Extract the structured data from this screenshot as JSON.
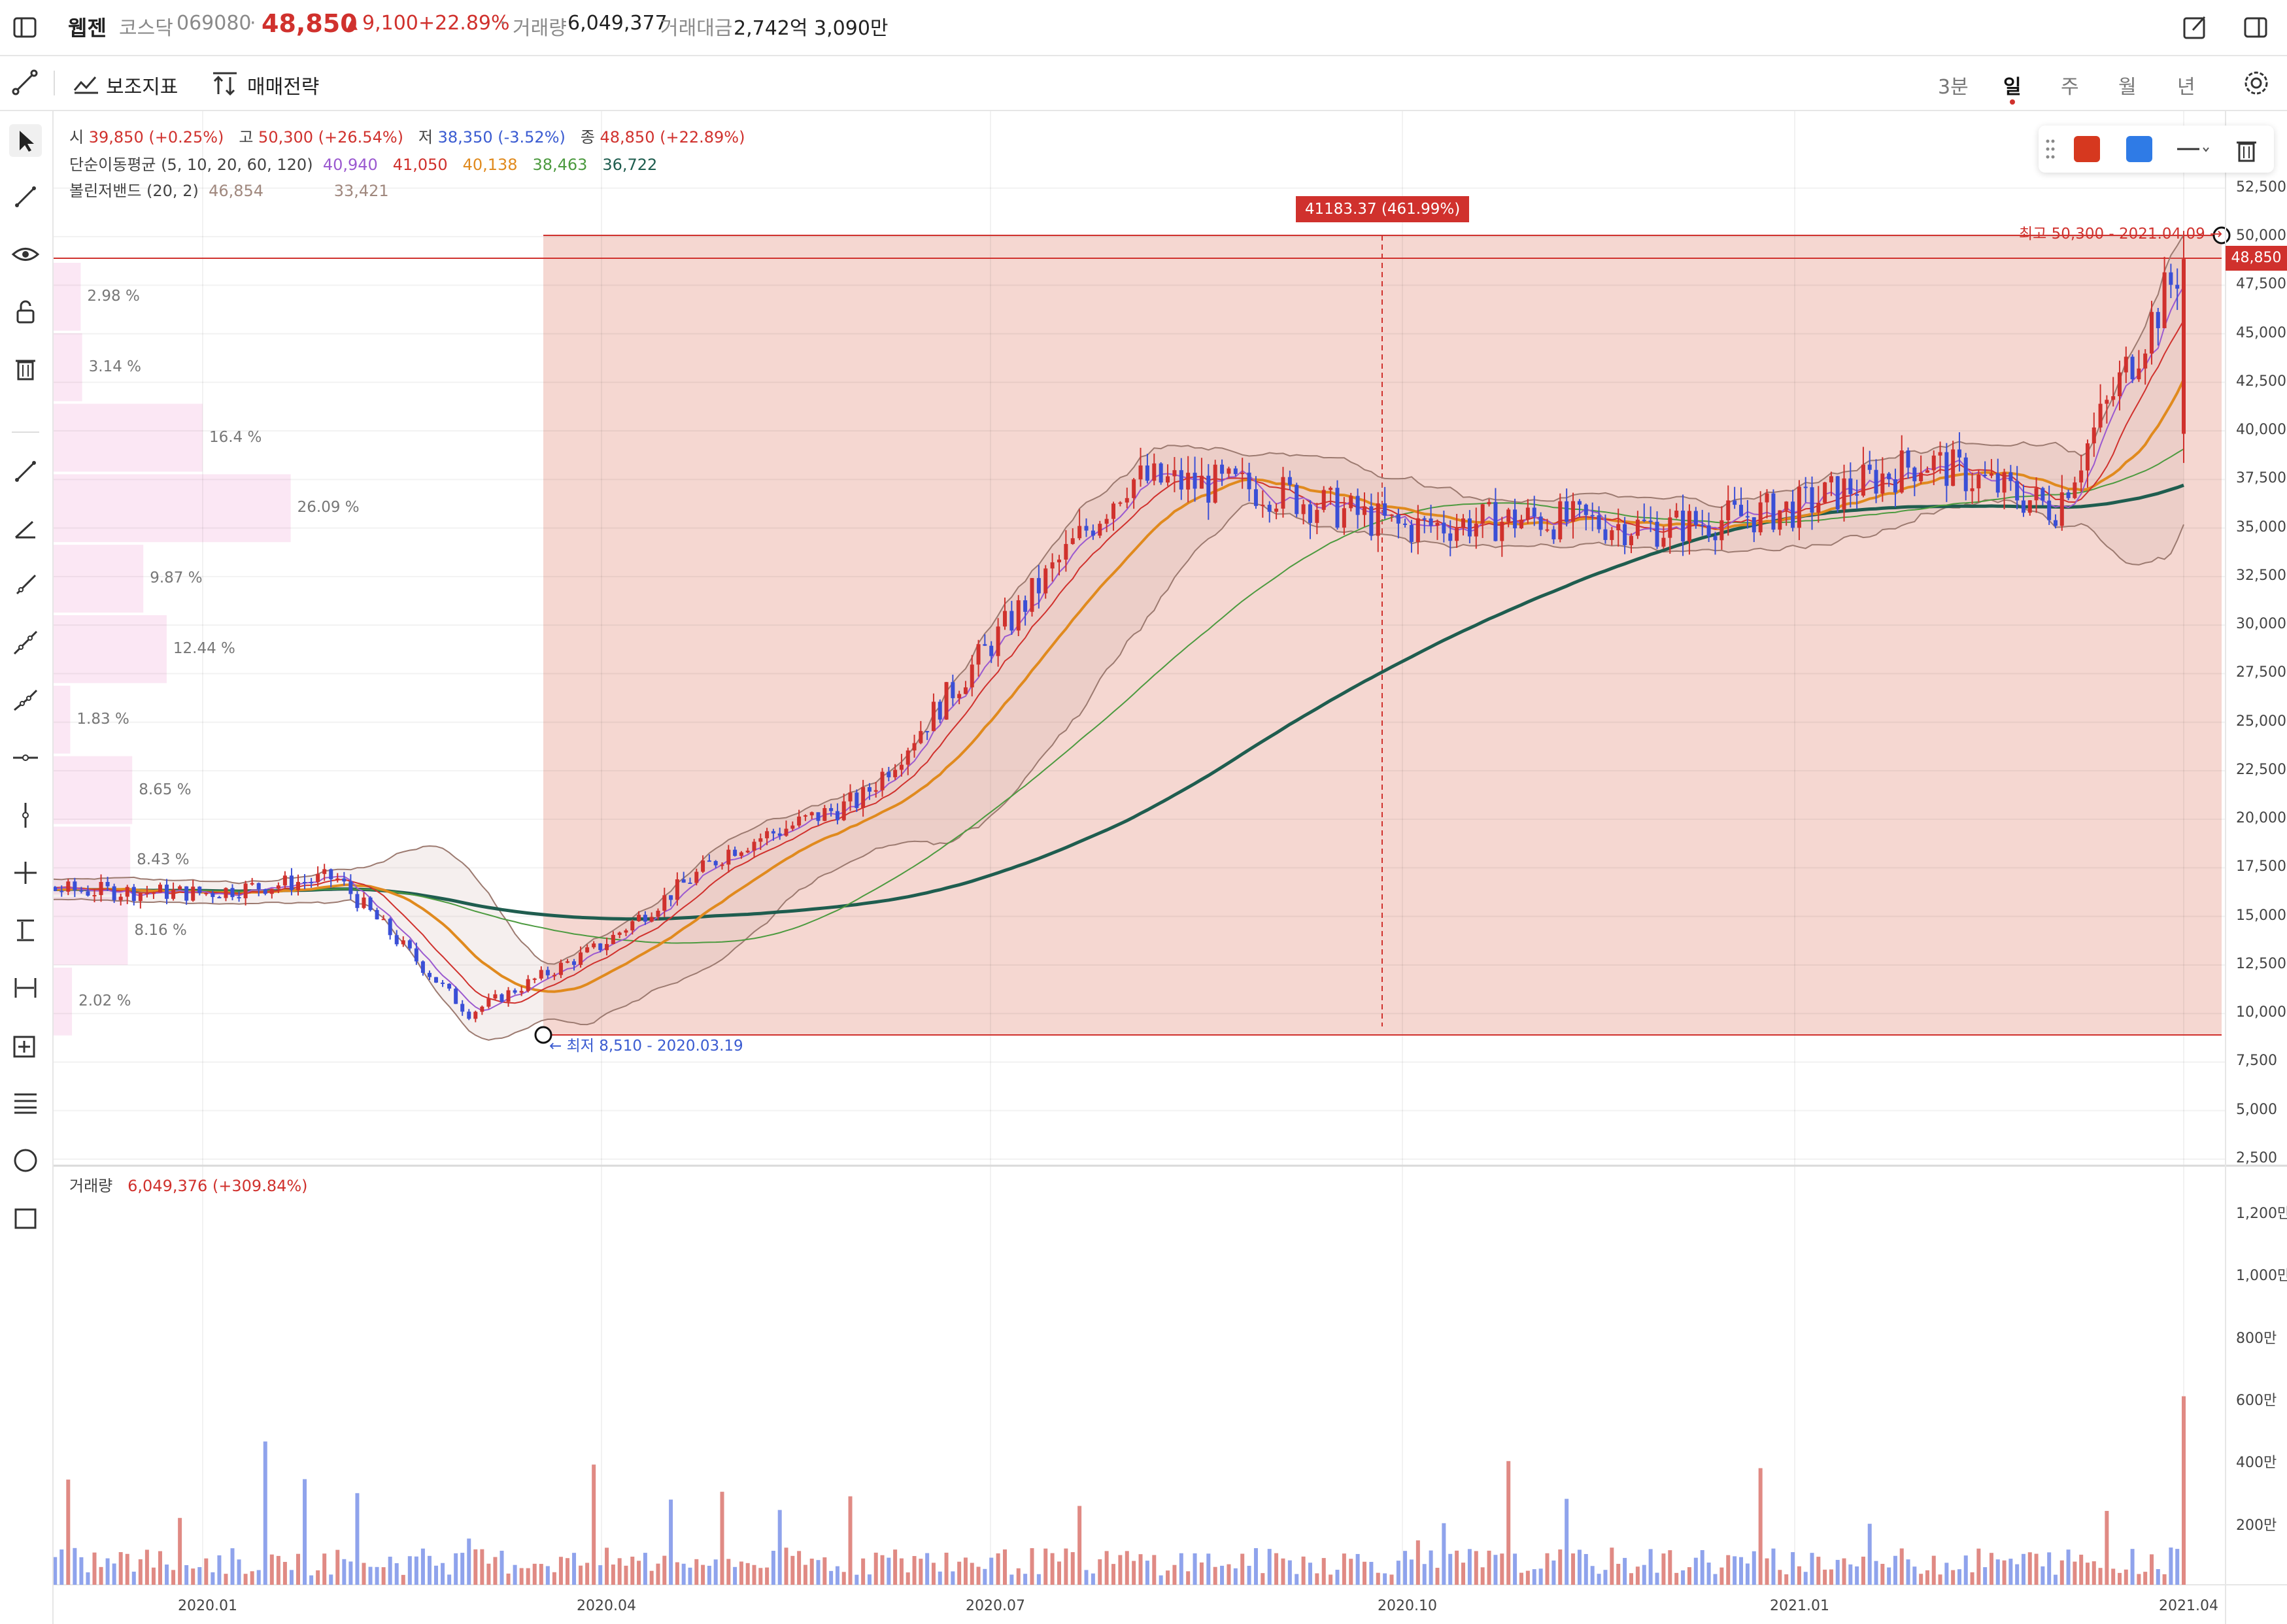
{
  "header": {
    "name": "웹젠",
    "market": "코스닥",
    "code": "069080",
    "price": "48,850",
    "change": "9,100",
    "change_pct": "+22.89%",
    "sep": "·",
    "volume_label": "거래량",
    "volume": "6,049,377",
    "value_label": "거래대금",
    "value": "2,742억 3,090만"
  },
  "toolbar": {
    "indicators_label": "보조지표",
    "strategy_label": "매매전략",
    "timeframes": [
      "3분",
      "일",
      "주",
      "월",
      "년"
    ],
    "active_timeframe": "일"
  },
  "legend": {
    "open_label": "시",
    "open": "39,850 (+0.25%)",
    "high_label": "고",
    "high": "50,300 (+26.54%)",
    "low_label": "저",
    "low": "38,350 (-3.52%)",
    "close_label": "종",
    "close": "48,850 (+22.89%)",
    "ma_label": "단순이동평균 (5, 10, 20, 60, 120)",
    "ma_values": [
      "40,940",
      "41,050",
      "40,138",
      "38,463",
      "36,722"
    ],
    "bb_label": "볼린저밴드 (20, 2)",
    "bb_values": [
      "46,854",
      "33,421"
    ]
  },
  "colors": {
    "up": "#d0312d",
    "down": "#3a4fd6",
    "ma5": "#9b59d0",
    "ma10": "#d0312d",
    "ma20": "#e08a1e",
    "ma60": "#4c9a3f",
    "ma120": "#1f5d4f",
    "region": "#f5d5d0",
    "vp": "#fbe7f4"
  },
  "measure": {
    "label": "41183.37  (461.99%)",
    "high_note": "최고 50,300 - 2021.04.09 →",
    "low_note": "← 최저 8,510 - 2020.03.19"
  },
  "price_tag": "48,850",
  "volume_profile": [
    "2.98 %",
    "3.14 %",
    "16.4 %",
    "26.09 %",
    "9.87 %",
    "12.44 %",
    "1.83 %",
    "8.65 %",
    "8.43 %",
    "8.16 %",
    "2.02 %"
  ],
  "volume_legend": {
    "label": "거래량",
    "value": "6,049,376 (+309.84%)"
  },
  "chart_data": [
    {
      "type": "candlestick",
      "title": "웹젠",
      "x": [
        "2020.01",
        "2020.04",
        "2020.07",
        "2020.10",
        "2021.01",
        "2021.04"
      ],
      "y_ticks": [
        "2,500",
        "5,000",
        "7,500",
        "10,000",
        "12,500",
        "15,000",
        "17,500",
        "20,000",
        "22,500",
        "25,000",
        "27,500",
        "30,000",
        "32,500",
        "35,000",
        "37,500",
        "40,000",
        "42,500",
        "45,000",
        "47,500",
        "50,000",
        "52,500"
      ],
      "ylim": [
        2500,
        52500
      ],
      "period": {
        "low": 8510,
        "low_date": "2020.03.19",
        "high": 50300,
        "high_date": "2021.04.09"
      },
      "last": {
        "open": 39850,
        "high": 50300,
        "low": 38350,
        "close": 48850
      },
      "close_trend": [
        {
          "x": "2019.11",
          "y": 16500
        },
        {
          "x": "2020.01",
          "y": 16200
        },
        {
          "x": "2020.02",
          "y": 17000
        },
        {
          "x": "2020.03",
          "y": 10000
        },
        {
          "x": "2020.04",
          "y": 13500
        },
        {
          "x": "2020.05",
          "y": 18500
        },
        {
          "x": "2020.06",
          "y": 21000
        },
        {
          "x": "2020.07",
          "y": 29000
        },
        {
          "x": "2020.08",
          "y": 37500
        },
        {
          "x": "2020.09",
          "y": 37000
        },
        {
          "x": "2020.10",
          "y": 35000
        },
        {
          "x": "2020.11",
          "y": 35500
        },
        {
          "x": "2020.12",
          "y": 35000
        },
        {
          "x": "2021.01",
          "y": 36000
        },
        {
          "x": "2021.02",
          "y": 38500
        },
        {
          "x": "2021.03",
          "y": 36000
        },
        {
          "x": "2021.04",
          "y": 48850
        }
      ]
    },
    {
      "type": "bar",
      "title": "거래량",
      "y_ticks": [
        "200만",
        "400만",
        "600만",
        "800만",
        "1,000만",
        "1,200만"
      ],
      "ylim": [
        0,
        12000000
      ],
      "last": 6049376
    }
  ]
}
